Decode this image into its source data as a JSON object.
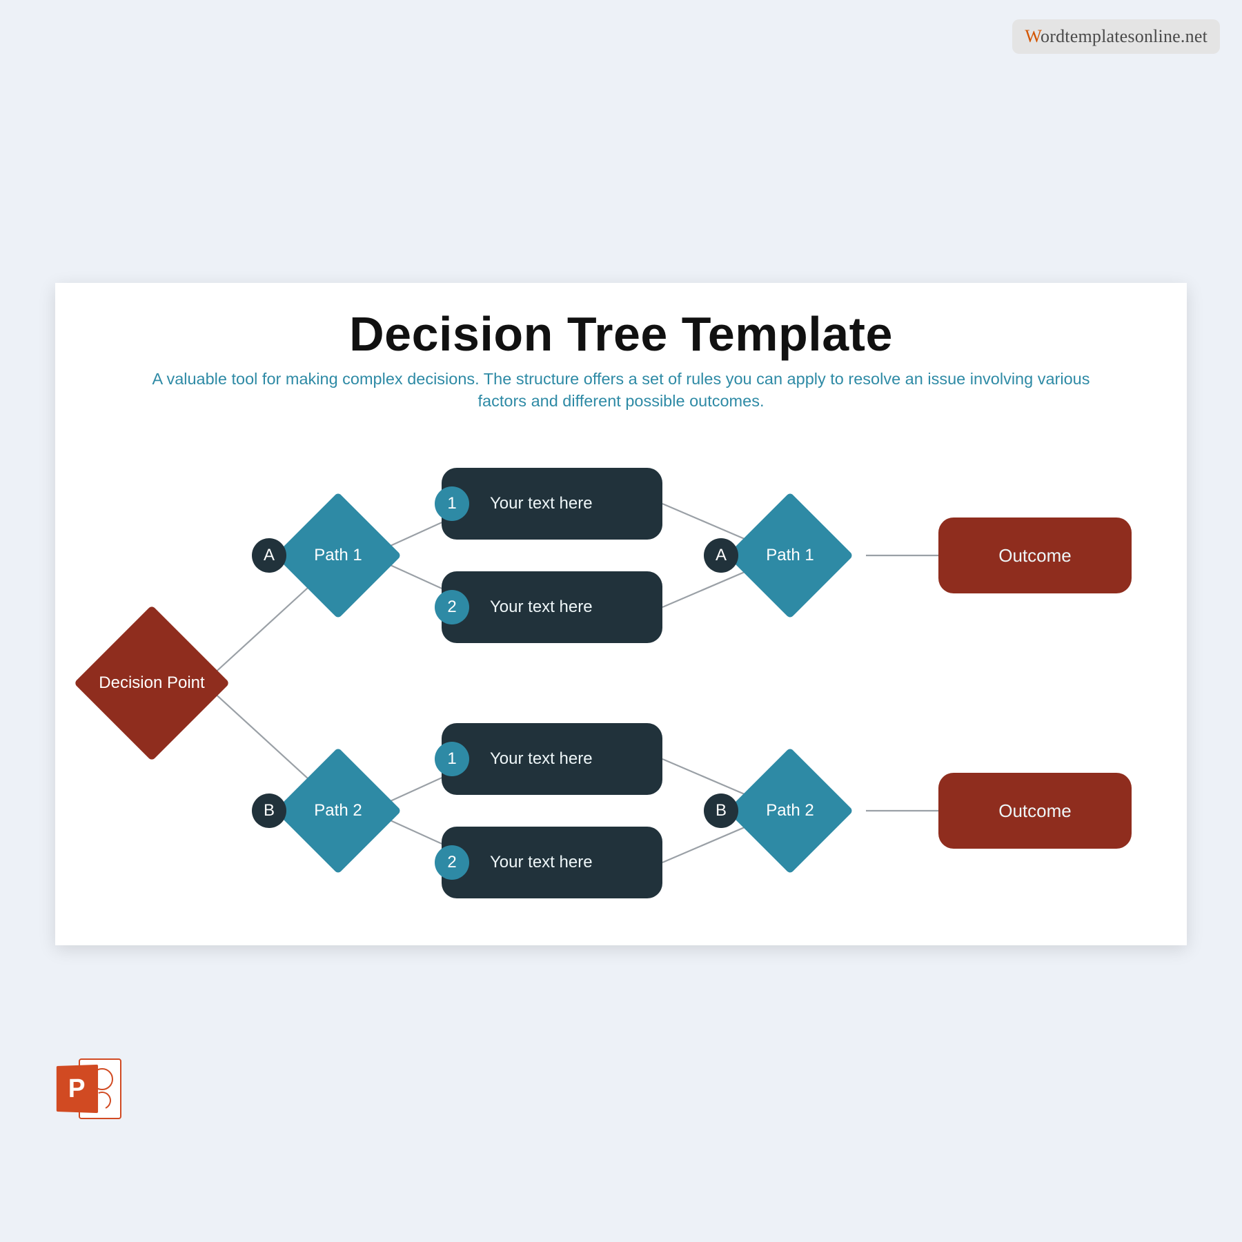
{
  "watermark": {
    "initial": "W",
    "rest": "ordtemplatesonline.net"
  },
  "slide": {
    "title": "Decision Tree Template",
    "subtitle": "A valuable tool for making complex decisions. The structure offers a set of rules you can apply to resolve an issue involving various factors and different possible outcomes."
  },
  "diagram": {
    "root": "Decision Point",
    "branches": [
      {
        "badge": "A",
        "path_label": "Path 1",
        "options": [
          {
            "num": "1",
            "text": "Your text here"
          },
          {
            "num": "2",
            "text": "Your text here"
          }
        ],
        "second_badge": "A",
        "second_path": "Path 1",
        "outcome": "Outcome"
      },
      {
        "badge": "B",
        "path_label": "Path 2",
        "options": [
          {
            "num": "1",
            "text": "Your text here"
          },
          {
            "num": "2",
            "text": "Your text here"
          }
        ],
        "second_badge": "B",
        "second_path": "Path 2",
        "outcome": "Outcome"
      }
    ]
  },
  "ppt_letter": "P"
}
